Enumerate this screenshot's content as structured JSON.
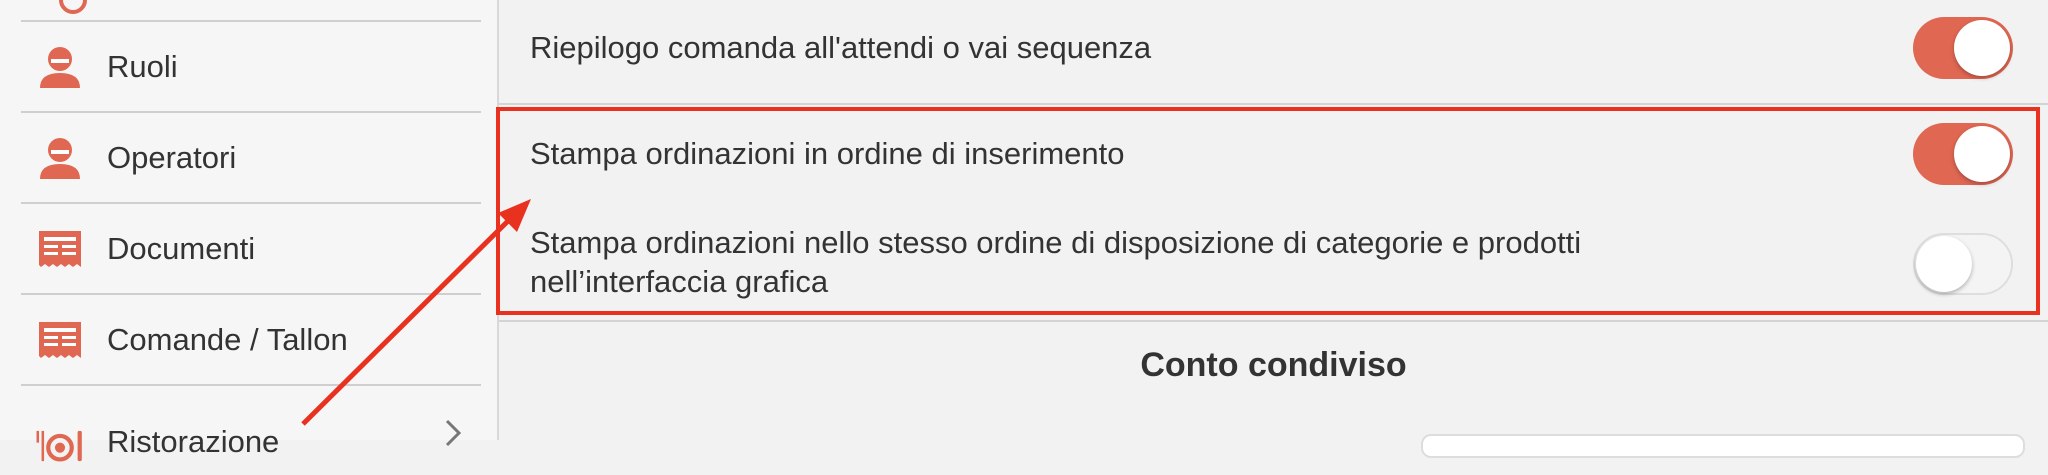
{
  "sidebar": {
    "items": [
      {
        "label": "Ruoli",
        "icon": "user-icon"
      },
      {
        "label": "Operatori",
        "icon": "user-icon"
      },
      {
        "label": "Documenti",
        "icon": "receipt-icon"
      },
      {
        "label": "Comande / Tallon",
        "icon": "receipt-icon"
      },
      {
        "label": "Ristorazione",
        "icon": "restaurant-icon",
        "has_chevron": true
      }
    ]
  },
  "settings": {
    "rows": [
      {
        "label": "Riepilogo comanda all'attendi o vai sequenza",
        "enabled": true
      },
      {
        "label": "Stampa ordinazioni in ordine di inserimento",
        "enabled": true
      },
      {
        "label_line1": "Stampa ordinazioni nello stesso ordine di disposizione di categorie e prodotti",
        "label_line2": "nell’interfaccia grafica",
        "enabled": false
      }
    ],
    "section_title": "Conto condiviso"
  },
  "colors": {
    "accent": "#e06752",
    "annotation": "#e8321f"
  }
}
